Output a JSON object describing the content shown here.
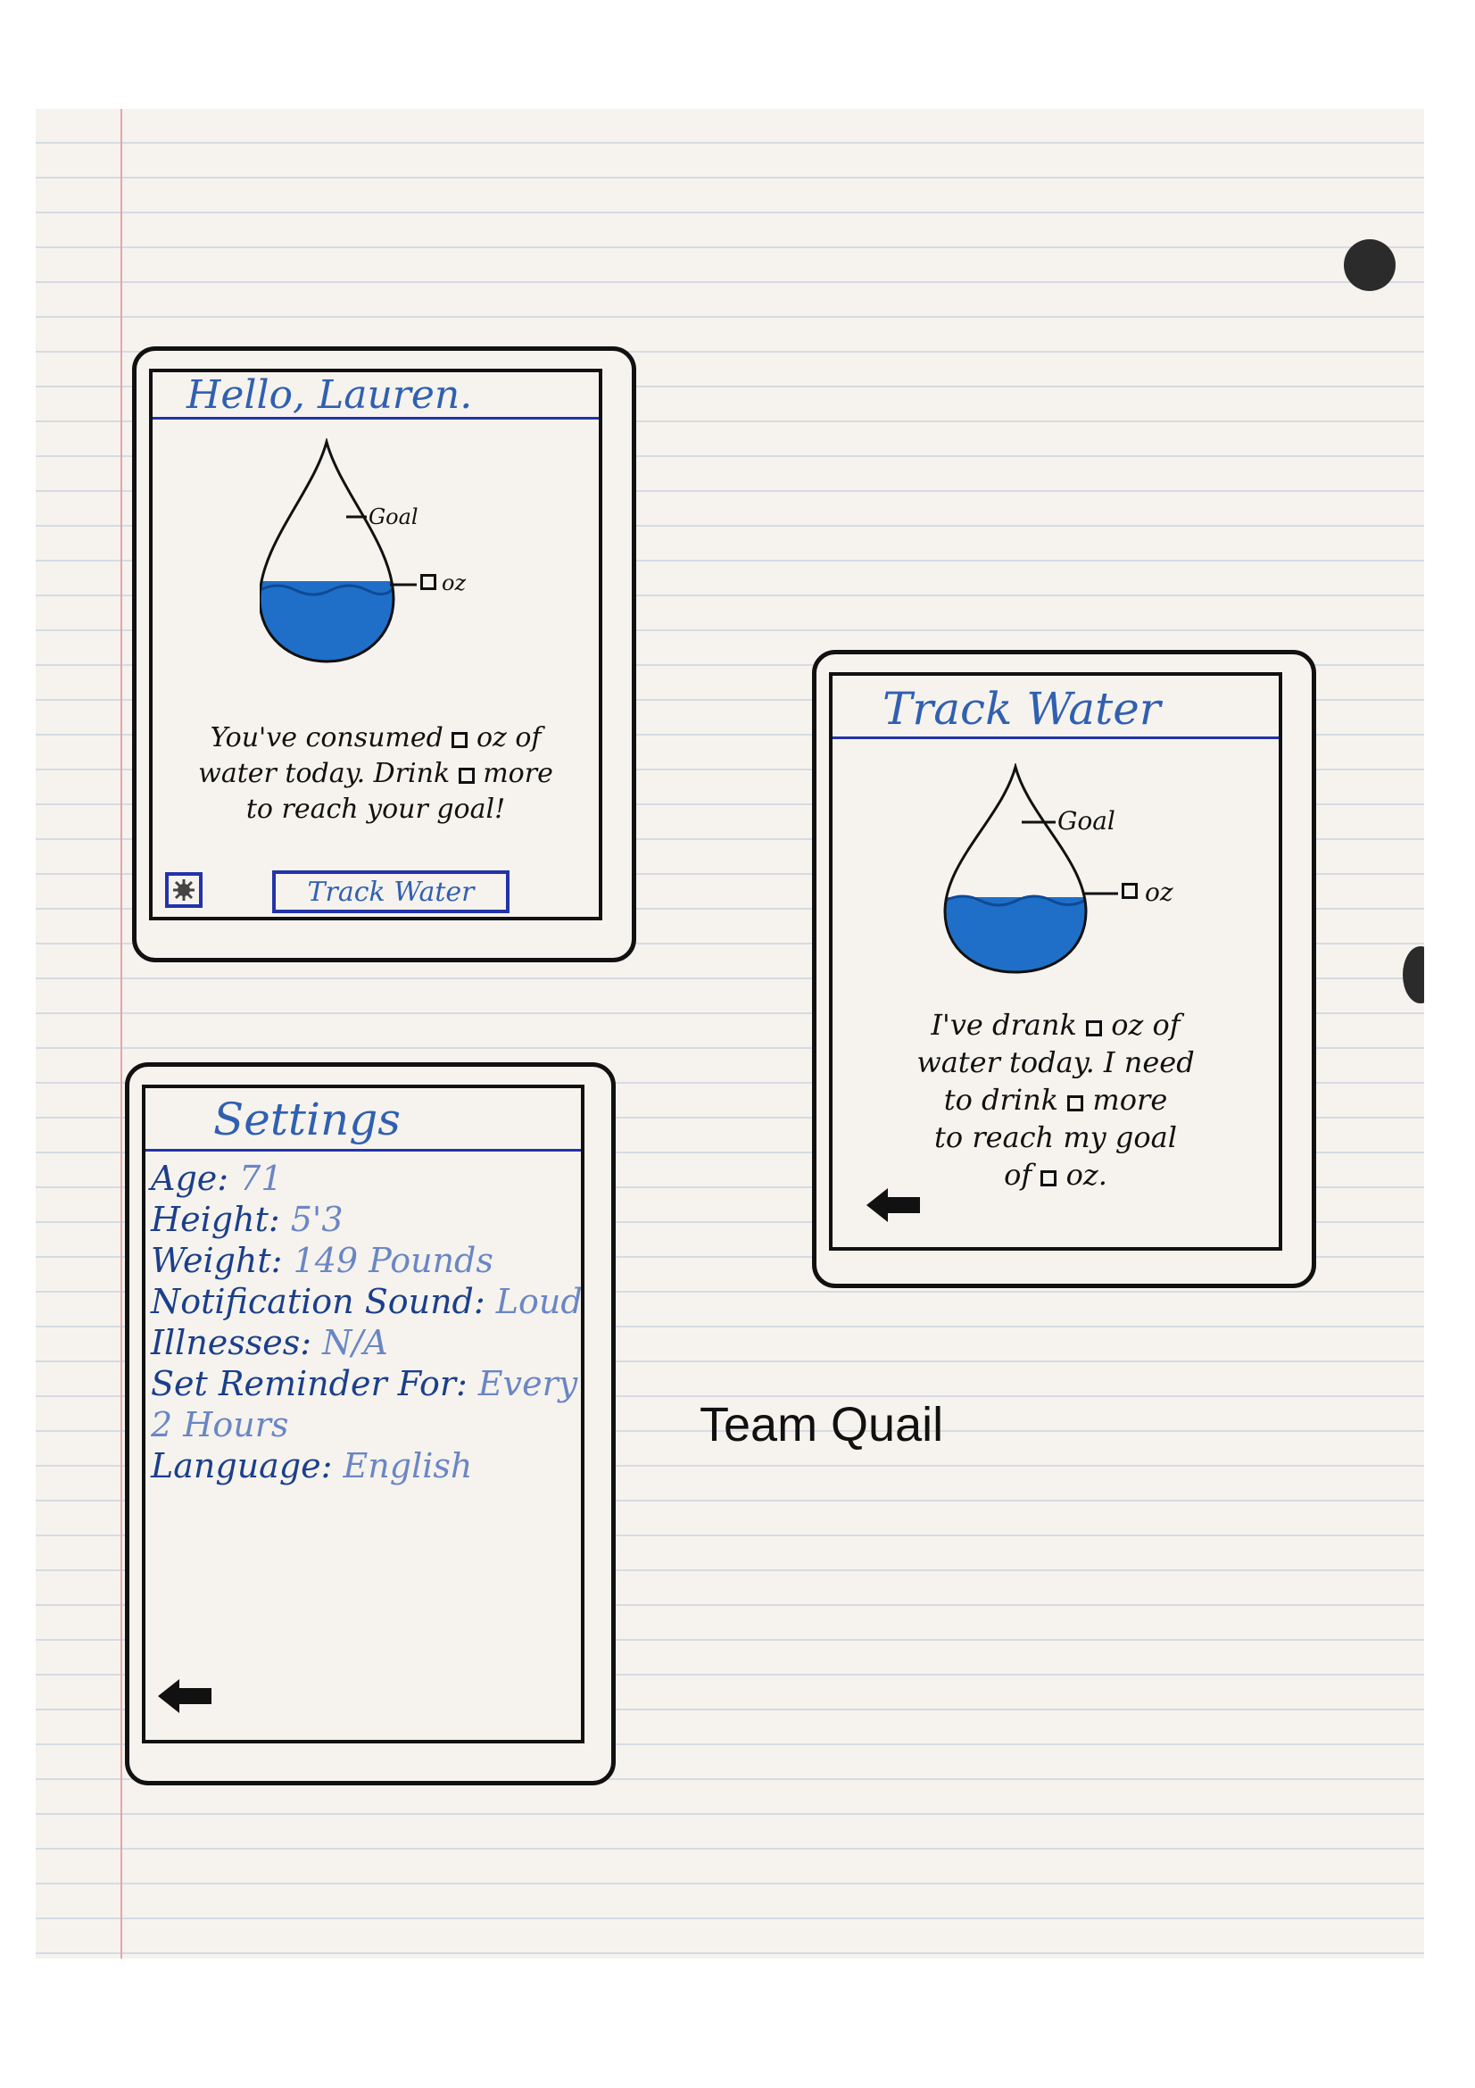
{
  "home": {
    "title": "Hello, Lauren.",
    "goal_label": "Goal",
    "oz_label": "oz",
    "message_1a": "You've consumed",
    "message_1b": "oz of",
    "message_2a": "water today. Drink",
    "message_2b": "more",
    "message_3": "to reach your goal!",
    "track_button": "Track Water",
    "fill_level": 0.35
  },
  "track": {
    "title": "Track Water",
    "goal_label": "Goal",
    "oz_label": "oz",
    "line_1a": "I've drank",
    "line_1b": "oz of",
    "line_2": "water today. I need",
    "line_3a": "to drink",
    "line_3b": "more",
    "line_4": "to reach my goal",
    "line_5a": "of",
    "line_5b": "oz.",
    "fill_level": 0.35
  },
  "settings": {
    "title": "Settings",
    "items": [
      {
        "label": "Age:",
        "value": "71"
      },
      {
        "label": "Height:",
        "value": "5'3"
      },
      {
        "label": "Weight:",
        "value": "149 Pounds"
      },
      {
        "label": "Notification Sound:",
        "value": "Loud"
      },
      {
        "label": "Illnesses:",
        "value": "N/A"
      },
      {
        "label": "Set Reminder For:",
        "value": "Every"
      },
      {
        "label": "",
        "value": "2 Hours"
      },
      {
        "label": "Language:",
        "value": "English"
      }
    ]
  },
  "footer": {
    "team": "Team Quail"
  },
  "colors": {
    "ink": "#111111",
    "header_blue": "#3060b0",
    "water": "#1f6fc8",
    "rule": "#2233aa"
  }
}
